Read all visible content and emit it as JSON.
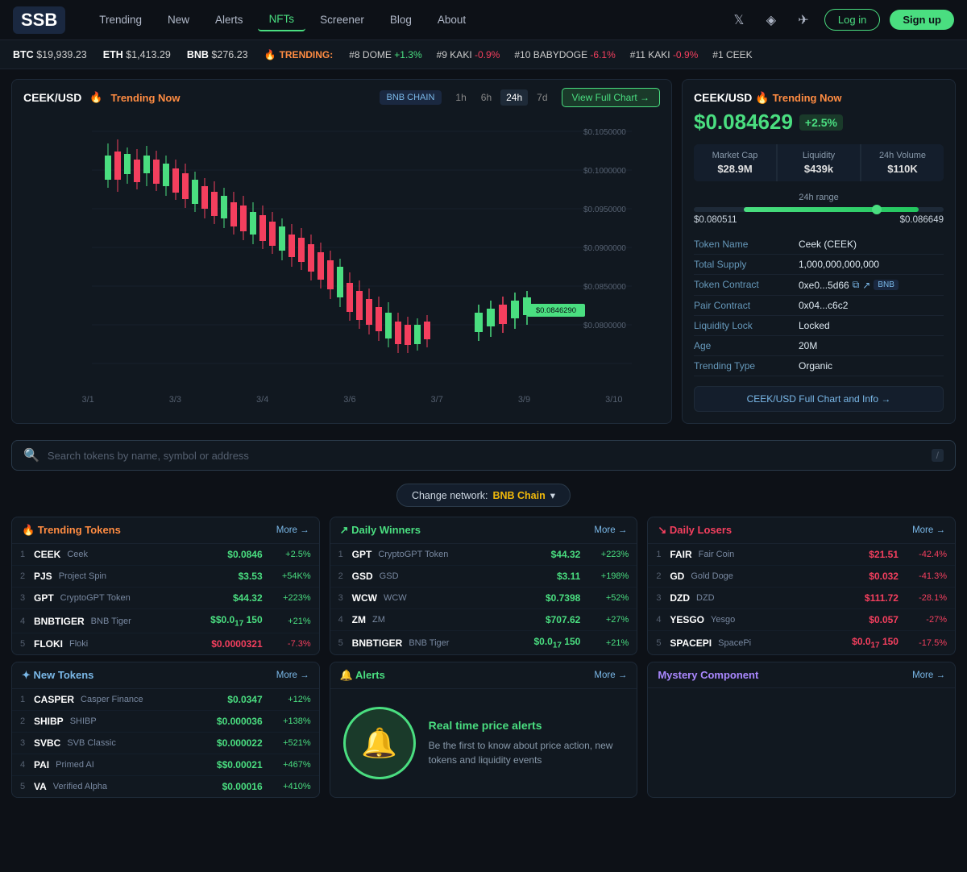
{
  "header": {
    "logo": "SSB",
    "nav": [
      {
        "label": "Trending",
        "active": false
      },
      {
        "label": "New",
        "active": false
      },
      {
        "label": "Alerts",
        "active": false
      },
      {
        "label": "NFTs",
        "active": true
      },
      {
        "label": "Screener",
        "active": false
      },
      {
        "label": "Blog",
        "active": false
      },
      {
        "label": "About",
        "active": false
      }
    ],
    "login": "Log in",
    "signup": "Sign up"
  },
  "ticker": {
    "btc_label": "BTC",
    "btc_price": "$19,939.23",
    "eth_label": "ETH",
    "eth_price": "$1,413.29",
    "bnb_label": "BNB",
    "bnb_price": "$276.23",
    "trending_label": "TRENDING:",
    "trending_tokens": [
      {
        "rank": "#8",
        "sym": "DOME",
        "change": "+1.3%"
      },
      {
        "rank": "#9",
        "sym": "KAKI",
        "change": "-0.9%"
      },
      {
        "rank": "#10",
        "sym": "BABYDOGE",
        "change": "-6.1%"
      },
      {
        "rank": "#11",
        "sym": "KAKI",
        "change": "-0.9%"
      },
      {
        "rank": "#1",
        "sym": "CEEK",
        "change": ""
      }
    ]
  },
  "chart": {
    "pair": "CEEK",
    "quote": "USD",
    "trending_label": "🔥 Trending Now",
    "chain": "BNB CHAIN",
    "timeframes": [
      "1h",
      "6h",
      "24h",
      "7d"
    ],
    "active_tf": "24h",
    "view_chart_btn": "View Full Chart →",
    "price_labels": [
      "$0.1050000",
      "$0.1000000",
      "$0.0950000",
      "$0.0900000",
      "$0.0850000",
      "$0.0800000"
    ],
    "date_labels": [
      "3/1",
      "3/3",
      "3/4",
      "3/6",
      "3/7",
      "3/9",
      "3/10"
    ],
    "current_price_label": "$0.0846290"
  },
  "right_panel": {
    "pair": "CEEK",
    "quote": "USD",
    "trending_label": "🔥 Trending Now",
    "price": "$0.084629",
    "price_change": "+2.5%",
    "market_cap_label": "Market Cap",
    "market_cap": "$28.9M",
    "liquidity_label": "Liquidity",
    "liquidity": "$439k",
    "volume_label": "24h Volume",
    "volume": "$110K",
    "range_label": "24h range",
    "range_low": "$0.080511",
    "range_high": "$0.086649",
    "token_name_label": "Token Name",
    "token_name": "Ceek (CEEK)",
    "total_supply_label": "Total Supply",
    "total_supply": "1,000,000,000,000",
    "contract_label": "Token Contract",
    "contract": "0xe0...5d66",
    "contract_badge": "BNB",
    "pair_contract_label": "Pair Contract",
    "pair_contract": "0x04...c6c2",
    "liquidity_lock_label": "Liquidity Lock",
    "liquidity_lock": "Locked",
    "age_label": "Age",
    "age": "20M",
    "trending_type_label": "Trending Type",
    "trending_type": "Organic",
    "full_chart_link": "CEEK/USD  Full Chart and Info →"
  },
  "search": {
    "placeholder": "Search tokens by name, symbol or address",
    "shortcut": "/"
  },
  "network": {
    "label": "Change network:",
    "network": "BNB Chain",
    "chevron": "▾"
  },
  "trending_tokens": {
    "title": "🔥 Trending Tokens",
    "more": "More →",
    "rows": [
      {
        "num": 1,
        "sym": "CEEK",
        "name": "Ceek",
        "price": "$0.0846",
        "change": "+2.5%",
        "pos": true
      },
      {
        "num": 2,
        "sym": "PJS",
        "name": "Project Spin",
        "price": "$3.53",
        "change": "+54K%",
        "pos": true
      },
      {
        "num": 3,
        "sym": "GPT",
        "name": "CryptoGPT Token",
        "price": "$44.32",
        "change": "+223%",
        "pos": true
      },
      {
        "num": 4,
        "sym": "BNBTIGER",
        "name": "BNB Tiger",
        "price": "$$0.0",
        "sub": "17",
        "extra": "150",
        "change": "+21%",
        "pos": true
      },
      {
        "num": 5,
        "sym": "FLOKI",
        "name": "Floki",
        "price": "$0.0000321",
        "change": "-7.3%",
        "pos": false
      }
    ]
  },
  "daily_winners": {
    "title": "↗ Daily Winners",
    "more": "More →",
    "rows": [
      {
        "num": 1,
        "sym": "GPT",
        "name": "CryptoGPT Token",
        "price": "$44.32",
        "change": "+223%",
        "pos": true
      },
      {
        "num": 2,
        "sym": "GSD",
        "name": "GSD",
        "price": "$3.11",
        "change": "+198%",
        "pos": true
      },
      {
        "num": 3,
        "sym": "WCW",
        "name": "WCW",
        "price": "$0.7398",
        "change": "+52%",
        "pos": true
      },
      {
        "num": 4,
        "sym": "ZM",
        "name": "ZM",
        "price": "$707.62",
        "change": "+27%",
        "pos": true
      },
      {
        "num": 5,
        "sym": "BNBTIGER",
        "name": "BNB Tiger",
        "price": "$0.0",
        "sub": "17",
        "extra": "150",
        "change": "+21%",
        "pos": true
      }
    ]
  },
  "daily_losers": {
    "title": "↘ Daily Losers",
    "more": "More →",
    "rows": [
      {
        "num": 1,
        "sym": "FAIR",
        "name": "Fair Coin",
        "price": "$21.51",
        "change": "-42.4%",
        "pos": false
      },
      {
        "num": 2,
        "sym": "GD",
        "name": "Gold Doge",
        "price": "$0.032",
        "change": "-41.3%",
        "pos": false
      },
      {
        "num": 3,
        "sym": "DZD",
        "name": "DZD",
        "price": "$111.72",
        "change": "-28.1%",
        "pos": false
      },
      {
        "num": 4,
        "sym": "YESGO",
        "name": "Yesgo",
        "price": "$0.057",
        "change": "-27%",
        "pos": false
      },
      {
        "num": 5,
        "sym": "SPACEPI",
        "name": "SpacePi",
        "price": "$0.0",
        "sub": "17",
        "extra": "150",
        "change": "-17.5%",
        "pos": false
      }
    ]
  },
  "new_tokens": {
    "title": "✦ New Tokens",
    "more": "More →",
    "rows": [
      {
        "num": 1,
        "sym": "CASPER",
        "name": "Casper Finance",
        "price": "$0.0347",
        "change": "+12%",
        "pos": true
      },
      {
        "num": 2,
        "sym": "SHIBP",
        "name": "SHIBP",
        "price": "$0.000036",
        "change": "+138%",
        "pos": true
      },
      {
        "num": 3,
        "sym": "SVBC",
        "name": "SVB Classic",
        "price": "$0.000022",
        "change": "+521%",
        "pos": true
      },
      {
        "num": 4,
        "sym": "PAI",
        "name": "Primed AI",
        "price": "$$0.00021",
        "change": "+467%",
        "pos": true
      },
      {
        "num": 5,
        "sym": "VA",
        "name": "Verified Alpha",
        "price": "$0.00016",
        "change": "+410%",
        "pos": true
      }
    ]
  },
  "alerts": {
    "title": "🔔 Alerts",
    "more": "More →",
    "heading": "Real time price alerts",
    "body": "Be the first to know about price action, new tokens and liquidity events"
  },
  "mystery": {
    "title": "Mystery Component",
    "more": "More →"
  }
}
